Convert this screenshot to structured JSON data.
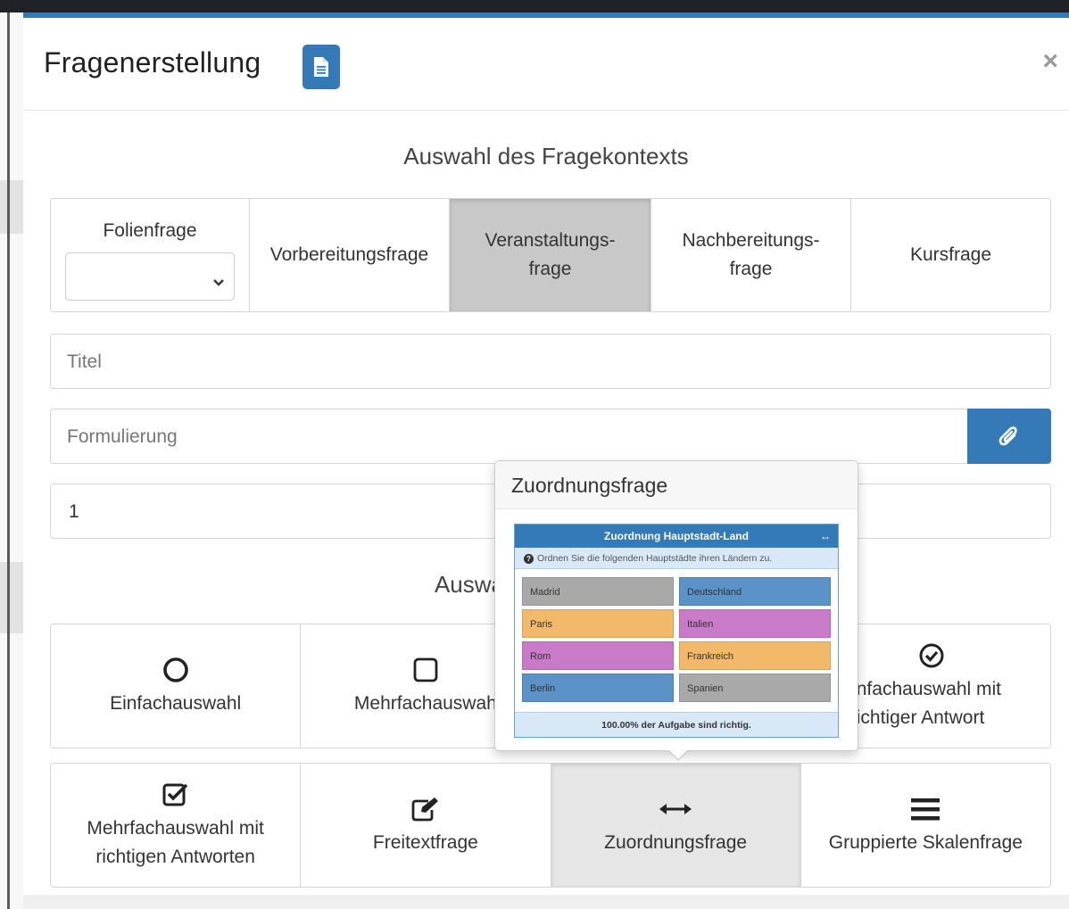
{
  "modal": {
    "title": "Fragenerstellung",
    "title_icon": "document-icon",
    "close": "×"
  },
  "context": {
    "heading": "Auswahl des Fragekontexts",
    "options": [
      {
        "label": "Folienfrage",
        "active": false,
        "select_value": ""
      },
      {
        "label": "Vorbereitungsfrage",
        "active": false
      },
      {
        "label": "Veranstaltungs-\nfrage",
        "active": true
      },
      {
        "label": "Nachbereitungs-\nfrage",
        "active": false
      },
      {
        "label": "Kursfrage",
        "active": false
      }
    ]
  },
  "fields": {
    "title_placeholder": "Titel",
    "formulation_placeholder": "Formulierung",
    "number_value": "1",
    "attach_icon": "paperclip-icon"
  },
  "type_section": {
    "heading": "Auswa"
  },
  "types": [
    {
      "label": "Einfachauswahl",
      "icon": "circle-icon"
    },
    {
      "label": "Mehrfachauswah",
      "icon": "square-icon"
    },
    {
      "label": "",
      "icon": ""
    },
    {
      "label": "nfachauswahl mit\nichtiger Antwort",
      "icon": "check-circle-icon"
    },
    {
      "label": "Mehrfachauswahl mit\nrichtigen Antworten",
      "icon": "check-square-icon"
    },
    {
      "label": "Freitextfrage",
      "icon": "edit-icon"
    },
    {
      "label": "Zuordnungsfrage",
      "icon": "arrows-h-icon",
      "active": true
    },
    {
      "label": "Gruppierte Skalenfrage",
      "icon": "bars-icon"
    }
  ],
  "popover": {
    "title": "Zuordnungsfrage",
    "preview": {
      "header": "Zuordnung Hauptstadt-Land",
      "header_icon": "↔",
      "instruction": "Ordnen Sie die folgenden Hauptstädte ihren Ländern zu.",
      "rows": [
        {
          "left": "Madrid",
          "right": "Deutschland",
          "left_color": "#a9a9a9",
          "right_color": "#5b93c8"
        },
        {
          "left": "Paris",
          "right": "Italien",
          "left_color": "#f2b96a",
          "right_color": "#c97ac9"
        },
        {
          "left": "Rom",
          "right": "Frankreich",
          "left_color": "#c97ac9",
          "right_color": "#f2b96a"
        },
        {
          "left": "Berlin",
          "right": "Spanien",
          "left_color": "#5b93c8",
          "right_color": "#a9a9a9"
        }
      ],
      "footer": "100.00% der Aufgabe sind richtig."
    }
  },
  "colors": {
    "accent": "#337ab7",
    "active_context": "#c8c8c8",
    "active_type": "#e6e6e6"
  }
}
